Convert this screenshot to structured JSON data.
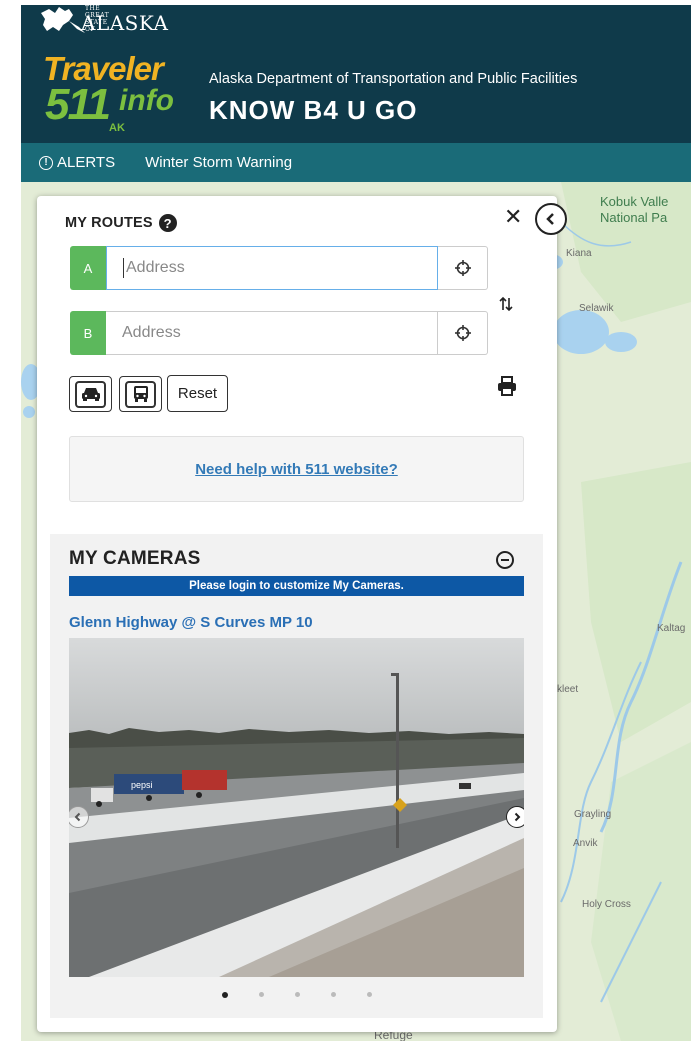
{
  "header": {
    "state_small": "THE GREAT STATE OF",
    "state_name": "ALASKA",
    "brand_traveler": "Traveler",
    "brand_511": "511",
    "brand_info": "info",
    "brand_ak": "AK",
    "department": "Alaska Department of Transportation and Public Facilities",
    "tagline": "KNOW B4 U GO"
  },
  "alerts": {
    "label": "ALERTS",
    "message": "Winter Storm Warning"
  },
  "map": {
    "labels": {
      "park": "Kobuk Valley National Park",
      "park_line1": "Kobuk Valle",
      "park_line2": "National Pa",
      "kiana": "Kiana",
      "selawik": "Selawik",
      "kaltag": "Kaltag",
      "nikleet": "kleet",
      "grayling": "Grayling",
      "anvik": "Anvik",
      "holy_cross": "Holy Cross",
      "refuge": "Refuge"
    }
  },
  "routes": {
    "title": "MY ROUTES",
    "a_label": "A",
    "b_label": "B",
    "a_placeholder": "Address",
    "b_placeholder": "Address",
    "reset_label": "Reset",
    "help_link": "Need help with 511 website?"
  },
  "cameras": {
    "title": "MY CAMERAS",
    "login_notice": "Please login to customize My Cameras.",
    "camera_name": "Glenn Highway @ S Curves MP 10",
    "truck_text": "pepsi",
    "slide_count": 5,
    "active_slide": 1
  },
  "colors": {
    "header_bg": "#0f3a4a",
    "alerts_bg": "#1a6b78",
    "brand_yellow": "#f0b323",
    "brand_green": "#7cbf3f",
    "tag_green": "#5cb85c",
    "login_bar": "#0d58a5",
    "link": "#337ab7"
  }
}
